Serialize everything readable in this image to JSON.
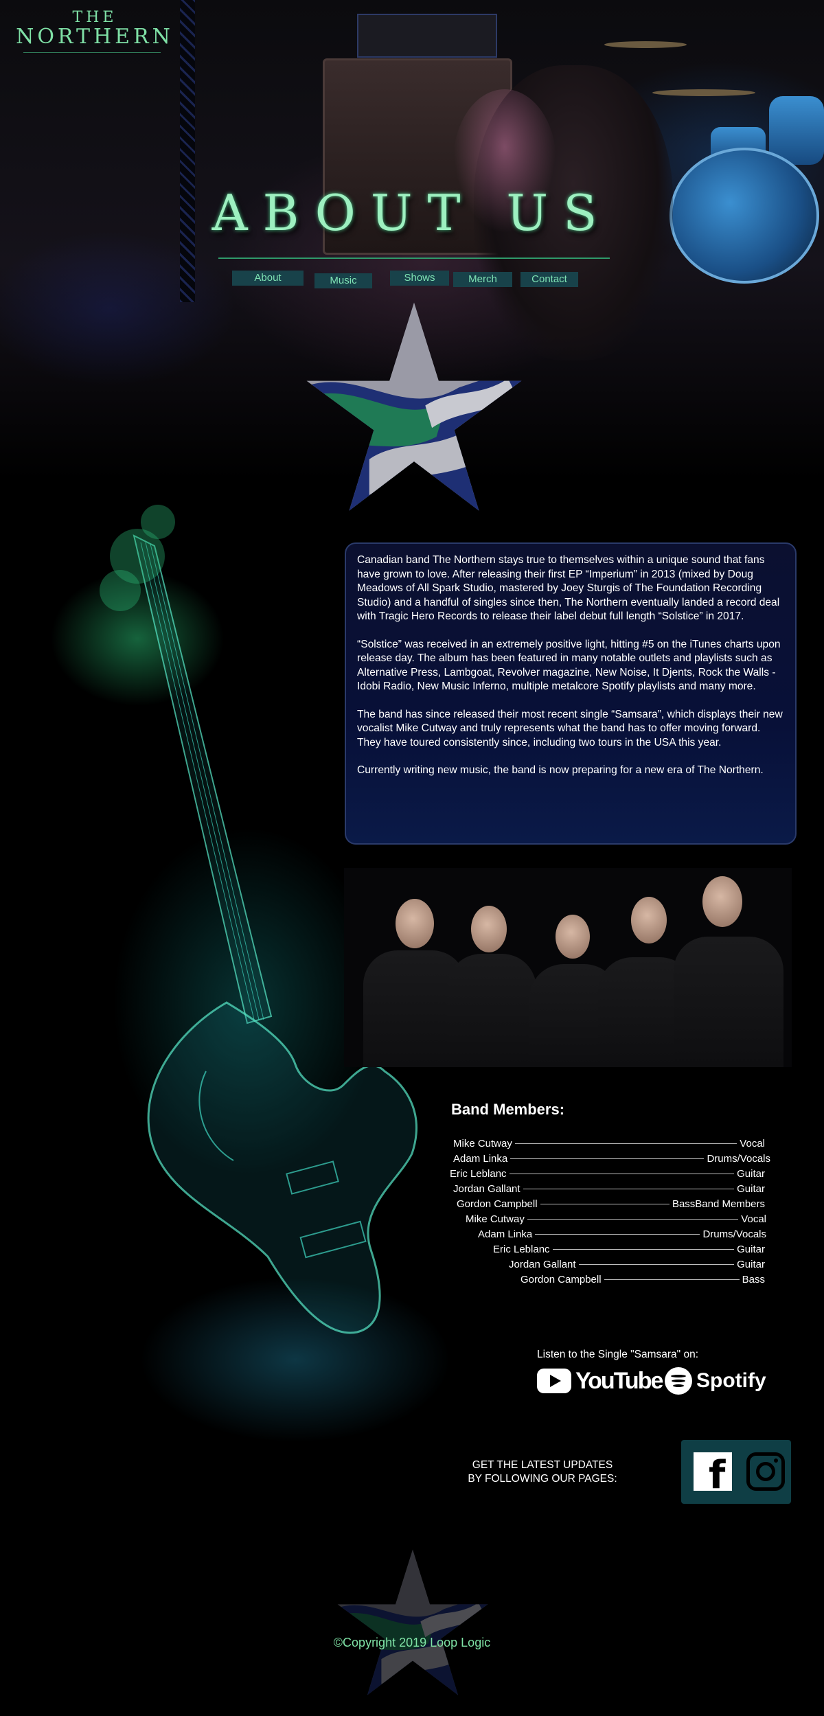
{
  "brand": {
    "the": "THE",
    "name": "NORTHERN"
  },
  "page_title": "ABOUT US",
  "nav": [
    {
      "label": "About"
    },
    {
      "label": "Music"
    },
    {
      "label": "Shows"
    },
    {
      "label": "Merch"
    },
    {
      "label": "Contact"
    }
  ],
  "about": {
    "paragraphs": [
      "Canadian band The Northern stays true to themselves within a unique sound that fans have grown to love. After releasing their first EP “Imperium” in 2013 (mixed by Doug Meadows of All Spark Studio, mastered by Joey Sturgis of The Foundation Recording Studio) and a handful of singles since then, The Northern eventually landed a record deal with Tragic Hero Records to release their label debut full length “Solstice” in 2017.",
      "“Solstice” was received in an extremely positive light, hitting #5 on the iTunes charts upon release day. The album has been featured in many notable outlets and playlists such as Alternative Press, Lambgoat, Revolver magazine, New Noise, It Djents, Rock the Walls - Idobi Radio, New Music Inferno, multiple metalcore Spotify playlists and many more.",
      "The band has since released their most recent single “Samsara”, which displays their new vocalist Mike Cutway and truly represents what the band has to offer moving forward. They have toured consistently since, including two tours in the USA this year.",
      "Currently writing new music, the band is now preparing for a new era of The Northern."
    ]
  },
  "members_title": "Band Members:",
  "members": [
    {
      "name": "Mike Cutway",
      "role": "Vocal"
    },
    {
      "name": "Adam Linka",
      "role": "Drums/Vocals"
    },
    {
      "name": "Eric Leblanc",
      "role": "Guitar"
    },
    {
      "name": "Jordan Gallant",
      "role": "Guitar"
    },
    {
      "name": "Gordon Campbell",
      "role": "BassBand Members"
    },
    {
      "name": "Mike Cutway",
      "role": "Vocal"
    },
    {
      "name": "Adam Linka",
      "role": "Drums/Vocals"
    },
    {
      "name": "Eric Leblanc",
      "role": "Guitar"
    },
    {
      "name": "Jordan Gallant",
      "role": "Guitar"
    },
    {
      "name": "Gordon Campbell",
      "role": "Bass"
    }
  ],
  "listen": {
    "label": "Listen to the Single \"Samsara\" on:",
    "youtube": "YouTube",
    "spotify": "Spotify"
  },
  "follow": {
    "line1": "GET THE LATEST UPDATES",
    "line2": "BY FOLLOWING OUR PAGES:"
  },
  "social": {
    "facebook_icon": "facebook-icon",
    "instagram_icon": "instagram-icon"
  },
  "copyright": "©Copyright 2019 Loop Logic",
  "colors": {
    "accent_green": "#7fe3a6",
    "nav_bg": "#18424a",
    "card_bg": "#0b1030",
    "social_bg": "#0f3e45",
    "star_green": "#1f7a55",
    "star_blue": "#1e2f74",
    "star_grey": "#9a9aa6"
  }
}
